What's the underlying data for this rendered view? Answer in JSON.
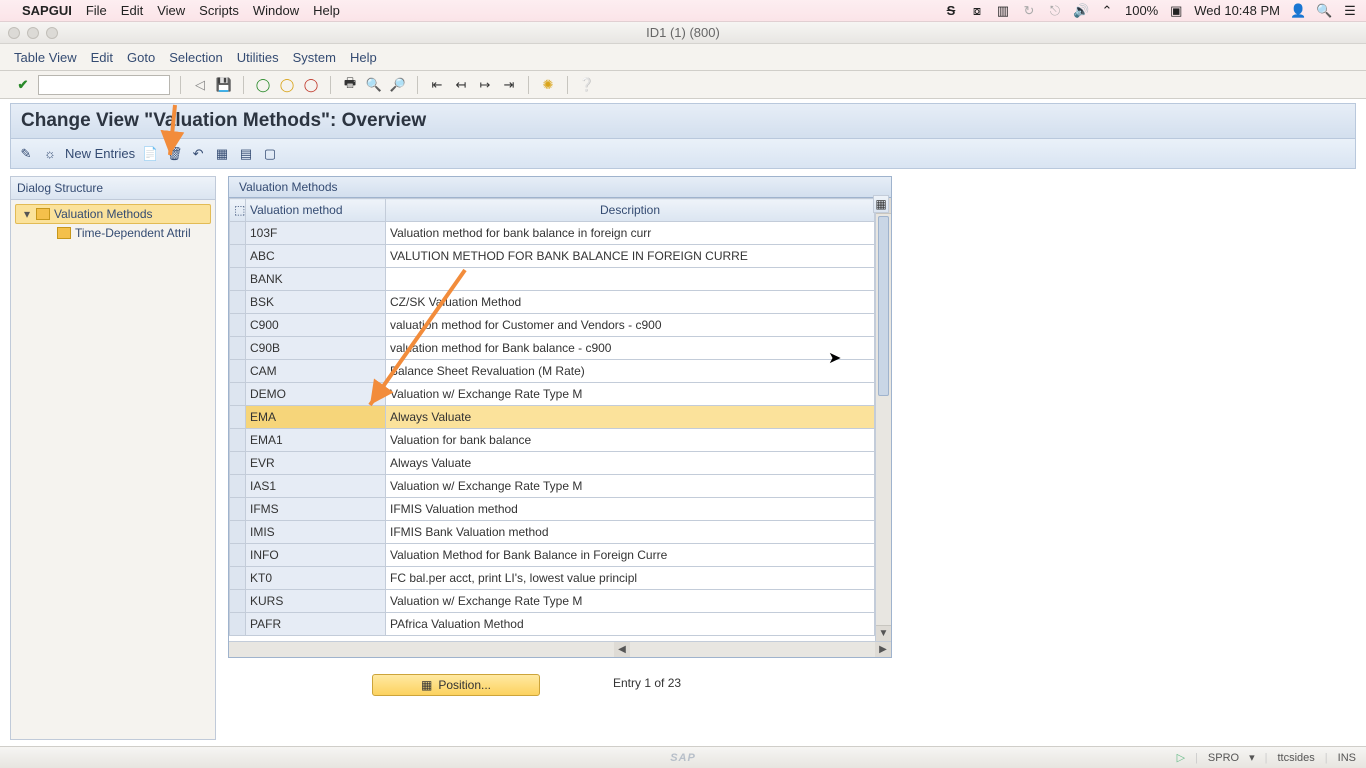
{
  "mac_menubar": {
    "app": "SAPGUI",
    "items": [
      "File",
      "Edit",
      "View",
      "Scripts",
      "Window",
      "Help"
    ],
    "right": {
      "battery": "100%",
      "day_time": "Wed 10:48 PM"
    }
  },
  "window_title": "ID1 (1) (800)",
  "app_menu": [
    "Table View",
    "Edit",
    "Goto",
    "Selection",
    "Utilities",
    "System",
    "Help"
  ],
  "view_title": "Change View \"Valuation Methods\": Overview",
  "subtoolbar": {
    "new_entries": "New Entries"
  },
  "sidebar": {
    "header": "Dialog Structure",
    "items": [
      {
        "label": "Valuation Methods",
        "selected": true
      },
      {
        "label": "Time-Dependent Attril",
        "selected": false
      }
    ]
  },
  "table": {
    "group_title": "Valuation Methods",
    "cols": [
      "Valuation method",
      "Description"
    ],
    "rows": [
      {
        "code": "103F",
        "desc": "Valuation method for bank balance in foreign curr"
      },
      {
        "code": "ABC",
        "desc": "VALUTION METHOD FOR BANK BALANCE IN FOREIGN CURRE"
      },
      {
        "code": "BANK",
        "desc": ""
      },
      {
        "code": "BSK",
        "desc": "CZ/SK Valuation Method"
      },
      {
        "code": "C900",
        "desc": "valuation method for Customer and Vendors - c900"
      },
      {
        "code": "C90B",
        "desc": "valuation method for Bank balance - c900"
      },
      {
        "code": "CAM",
        "desc": "Balance Sheet Revaluation (M Rate)"
      },
      {
        "code": "DEMO",
        "desc": "Valuation w/ Exchange Rate Type M"
      },
      {
        "code": "EMA",
        "desc": "Always Valuate",
        "selected": true
      },
      {
        "code": "EMA1",
        "desc": "Valuation for bank balance"
      },
      {
        "code": "EVR",
        "desc": "Always Valuate"
      },
      {
        "code": "IAS1",
        "desc": "Valuation w/ Exchange Rate Type M"
      },
      {
        "code": "IFMS",
        "desc": "IFMIS Valuation method"
      },
      {
        "code": "IMIS",
        "desc": "IFMIS Bank Valuation method"
      },
      {
        "code": "INFO",
        "desc": "Valuation Method for Bank Balance in Foreign Curre"
      },
      {
        "code": "KT0",
        "desc": "FC bal.per acct, print LI's, lowest value principl"
      },
      {
        "code": "KURS",
        "desc": "Valuation w/ Exchange Rate Type M"
      },
      {
        "code": "PAFR",
        "desc": "PAfrica Valuation Method"
      }
    ]
  },
  "position_button": "Position...",
  "entry_status": "Entry 1 of 23",
  "statusbar": {
    "logo": "SAP",
    "tcode": "SPRO",
    "user": "ttcsides",
    "mode": "INS"
  }
}
